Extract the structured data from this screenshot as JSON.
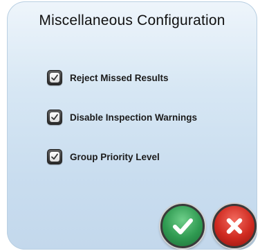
{
  "dialog": {
    "title": "Miscellaneous Configuration"
  },
  "options": [
    {
      "label": "Reject Missed Results",
      "checked": true
    },
    {
      "label": "Disable Inspection Warnings",
      "checked": true
    },
    {
      "label": "Group Priority Level",
      "checked": true
    }
  ],
  "buttons": {
    "ok_icon": "checkmark-icon",
    "cancel_icon": "x-icon"
  },
  "colors": {
    "ok": "#2f9a51",
    "cancel": "#cf2a20",
    "dialog_bg": "#c9ddef"
  }
}
